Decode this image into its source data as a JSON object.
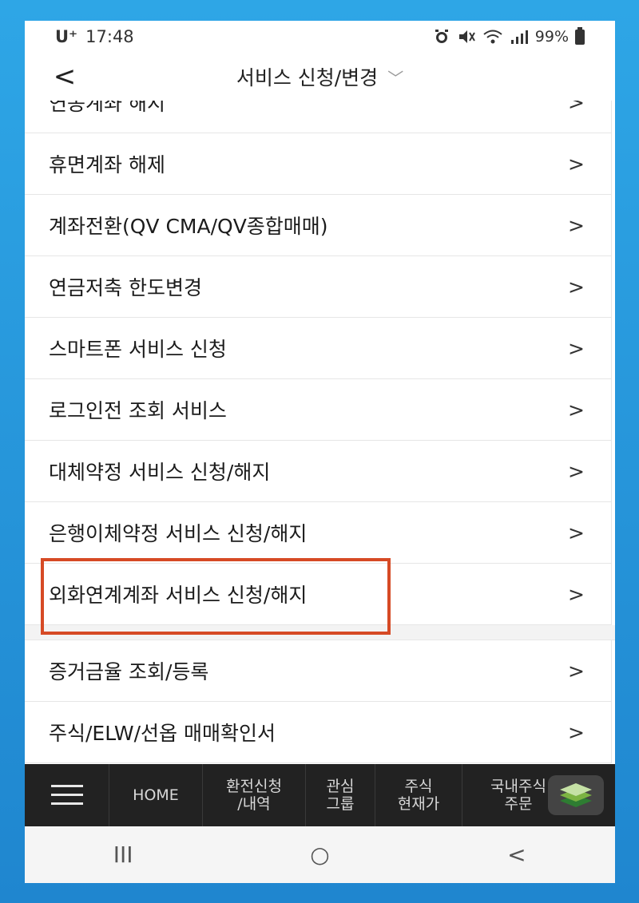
{
  "status_bar": {
    "carrier": "U⁺",
    "time": "17:48",
    "icons": [
      "alarm-icon",
      "mute-icon",
      "wifi-icon",
      "signal-icon"
    ],
    "battery": "99%"
  },
  "header": {
    "back_icon": "<",
    "title": "서비스 신청/변경",
    "dropdown_icon": "﹀"
  },
  "list": {
    "items": [
      {
        "label": "연동계좌 해지",
        "chevron": ">"
      },
      {
        "label": "휴면계좌 해제",
        "chevron": ">"
      },
      {
        "label": "계좌전환(QV CMA/QV종합매매)",
        "chevron": ">"
      },
      {
        "label": "연금저축 한도변경",
        "chevron": ">"
      },
      {
        "label": "스마트폰 서비스 신청",
        "chevron": ">"
      },
      {
        "label": "로그인전 조회 서비스",
        "chevron": ">"
      },
      {
        "label": "대체약정 서비스 신청/해지",
        "chevron": ">"
      },
      {
        "label": "은행이체약정 서비스 신청/해지",
        "chevron": ">"
      },
      {
        "label": "외화연계계좌 서비스 신청/해지",
        "chevron": ">"
      }
    ],
    "items2": [
      {
        "label": "증거금율 조회/등록",
        "chevron": ">"
      },
      {
        "label": "주식/ELW/선옵 매매확인서",
        "chevron": ">"
      }
    ]
  },
  "app_nav": {
    "items": [
      "HOME",
      "환전신청\n/내역",
      "관심\n그룹",
      "주식\n현재가",
      "국내주식\n주문"
    ],
    "menu_icon": "hamburger-icon",
    "layers_icon": "layers-icon"
  },
  "system_nav": {
    "recents": "III",
    "home": "○",
    "back": "<"
  },
  "colors": {
    "highlight": "#d64a25",
    "app_nav_bg": "#222222",
    "background": "#2ea6e6"
  }
}
